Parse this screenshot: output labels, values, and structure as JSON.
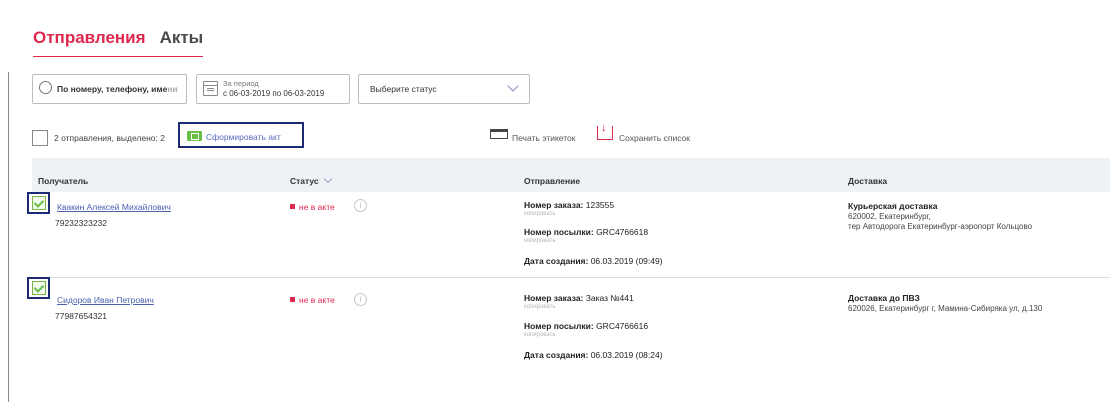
{
  "tabs": [
    {
      "label": "Отправления",
      "active": true
    },
    {
      "label": "Акты",
      "active": false
    }
  ],
  "filters": {
    "search_placeholder": "По номеру, телефону, име",
    "search_placeholder_fade": "ни",
    "period_label": "За период",
    "period_value": "с 06-03-2019 по 06-03-2019",
    "status_placeholder": "Выберите статус"
  },
  "actions": {
    "summary": "2 отправления, выделено: 2",
    "create_act_label": "Сформировать акт",
    "print_labels_label": "Печать этикеток",
    "save_list_label": "Сохранить список"
  },
  "table": {
    "headers": {
      "recipient": "Получатель",
      "status": "Статус",
      "shipment": "Отправление",
      "delivery": "Доставка"
    },
    "rows": [
      {
        "checked": true,
        "recipient_name": "Квакин Алексей Михайлович",
        "recipient_phone": "79232323232",
        "status": "не в акте",
        "order_label": "Номер заказа:",
        "order_value": " 123555",
        "copy": "копировать",
        "parcel_label": "Номер посылки:",
        "parcel_value": " GRC4766618",
        "created_label": "Дата создания:",
        "created_value": " 06.03.2019 (09:49)",
        "delivery_type": "Курьерская доставка",
        "delivery_addr_1": "620002, Екатеринбург,",
        "delivery_addr_2": "тер Автодорога Екатеринбург-аэропорт Кольцово"
      },
      {
        "checked": true,
        "recipient_name": "Сидоров Иван Петрович",
        "recipient_phone": "77987654321",
        "status": "не в акте",
        "order_label": "Номер заказа:",
        "order_value": " Заказ №441",
        "copy": "копировать",
        "parcel_label": "Номер посылки:",
        "parcel_value": " GRC4766616",
        "created_label": "Дата создания:",
        "created_value": " 06.03.2019 (08:24)",
        "delivery_type": "Доставка до ПВЗ",
        "delivery_addr_1": "620026, Екатеринбург г, Мамина-Сибиряка ул, д.130"
      }
    ]
  },
  "colors": {
    "accent": "#e0284f",
    "link": "#4a5fb0",
    "highlight_outline": "#1c2a75",
    "check_green": "#6ac046"
  }
}
